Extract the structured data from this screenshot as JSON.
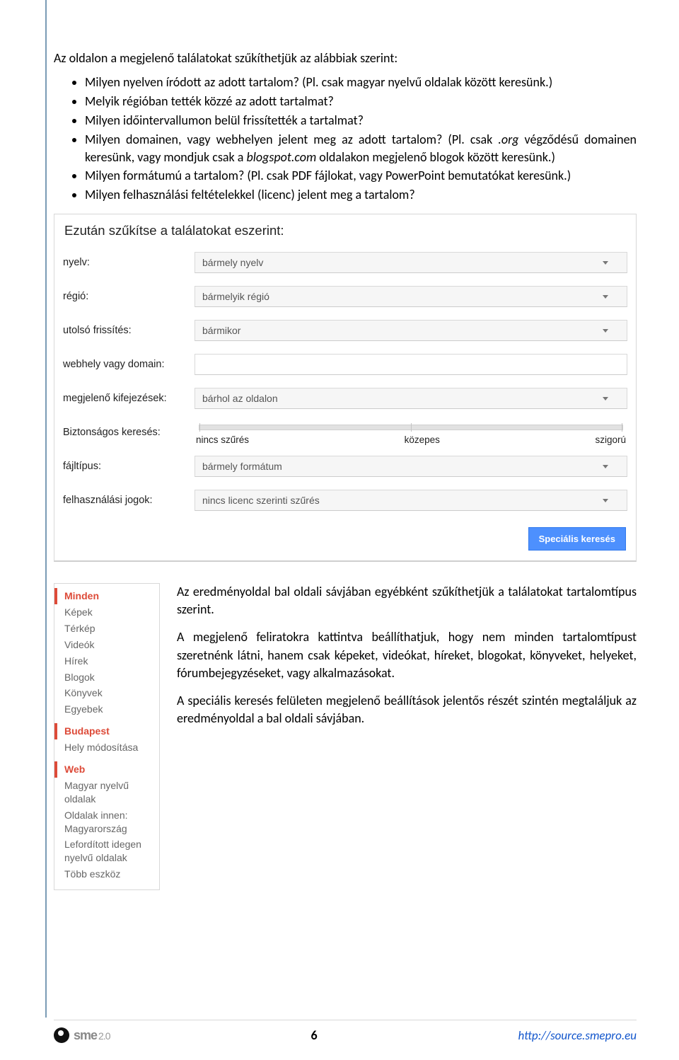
{
  "intro": "Az oldalon a megjelenő találatokat szűkíthetjük az alábbiak szerint:",
  "bullets": {
    "b0": "Milyen nyelven íródott az adott tartalom? (Pl. csak magyar nyelvű oldalak között keresünk.)",
    "b1": "Melyik régióban tették közzé az adott tartalmat?",
    "b2": "Milyen időintervallumon belül frissítették a tartalmat?",
    "b3_a": "Milyen domainen, vagy webhelyen jelent meg az adott tartalom? (Pl. csak ",
    "b3_i1": ".org",
    "b3_b": " végződésű domainen keresünk, vagy mondjuk csak a ",
    "b3_i2": "blogspot.com",
    "b3_c": " oldalakon megjelenő blogok között keresünk.)",
    "b4": "Milyen formátumú a tartalom? (Pl. csak PDF fájlokat, vagy PowerPoint bemutatókat keresünk.)",
    "b5": "Milyen felhasználási feltételekkel (licenc) jelent meg a tartalom?"
  },
  "adv": {
    "title": "Ezután szűkítse a találatokat eszerint:",
    "labels": {
      "lang": "nyelv:",
      "region": "régió:",
      "updated": "utolsó frissítés:",
      "site": "webhely vagy domain:",
      "terms": "megjelenő kifejezések:",
      "safe": "Biztonságos keresés:",
      "filetype": "fájltípus:",
      "rights": "felhasználási jogok:"
    },
    "values": {
      "lang": "bármely nyelv",
      "region": "bármelyik régió",
      "updated": "bármikor",
      "site": "",
      "terms": "bárhol az oldalon",
      "filetype": "bármely formátum",
      "rights": "nincs licenc szerinti szűrés"
    },
    "slider": {
      "l0": "nincs szűrés",
      "l1": "közepes",
      "l2": "szigorú"
    },
    "button": "Speciális keresés"
  },
  "sidebar": [
    {
      "label": "Minden",
      "active": true
    },
    {
      "label": "Képek"
    },
    {
      "label": "Térkép"
    },
    {
      "label": "Videók"
    },
    {
      "label": "Hírek"
    },
    {
      "label": "Blogok"
    },
    {
      "label": "Könyvek"
    },
    {
      "label": "Egyebek"
    },
    {
      "spacer": true
    },
    {
      "label": "Budapest",
      "active": true
    },
    {
      "label": "Hely módosítása"
    },
    {
      "spacer": true
    },
    {
      "label": "Web",
      "active": true
    },
    {
      "label": "Magyar nyelvű oldalak"
    },
    {
      "label": "Oldalak innen: Magyarország"
    },
    {
      "label": "Lefordított idegen nyelvű oldalak"
    },
    {
      "label": "Több eszköz"
    }
  ],
  "right": {
    "p1": "Az eredményoldal bal oldali sávjában egyébként szűkíthetjük a találatokat tartalomtípus szerint.",
    "p2": "A megjelenő feliratokra kattintva beállíthatjuk, hogy nem minden tartalomtípust szeretnénk látni, hanem csak képeket, videókat, híreket, blogokat, könyveket, helyeket, fórumbejegyzéseket, vagy alkalmazásokat.",
    "p3": "A speciális keresés felületen megjelenő beállítások jelentős részét szintén megtaláljuk az eredményoldal a bal oldali sávjában."
  },
  "footer": {
    "brand": "sme",
    "brand2": "2.0",
    "page": "6",
    "url": "http://source.smepro.eu"
  }
}
